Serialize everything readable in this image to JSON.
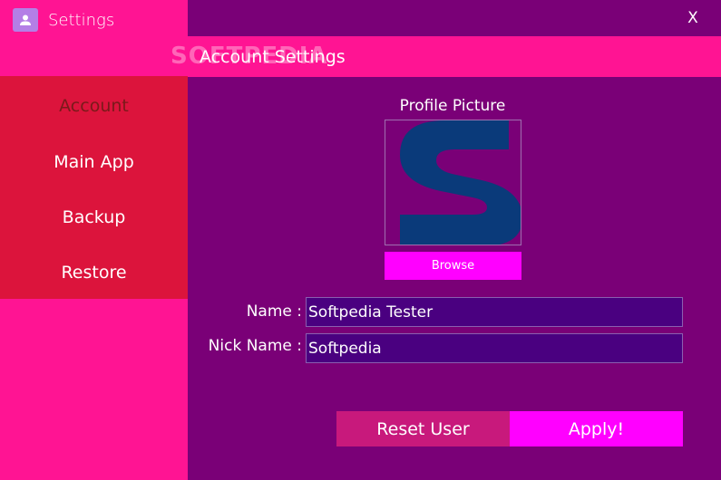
{
  "window": {
    "title": "Settings",
    "close_label": "X"
  },
  "sidebar": {
    "items": [
      {
        "label": "Account",
        "active": true
      },
      {
        "label": "Main App",
        "active": false
      },
      {
        "label": "Backup",
        "active": false
      },
      {
        "label": "Restore",
        "active": false
      }
    ]
  },
  "watermark": "SOFTPEDIA",
  "section": {
    "title": "Account Settings"
  },
  "profile": {
    "label": "Profile Picture",
    "browse_label": "Browse",
    "image_letter": "S"
  },
  "form": {
    "name_label": "Name :",
    "name_value": "Softpedia Tester",
    "nick_label": "Nick Name :",
    "nick_value": "Softpedia"
  },
  "actions": {
    "reset_label": "Reset User",
    "apply_label": "Apply!"
  },
  "colors": {
    "accent_pink": "#ff1493",
    "nav_red": "#dc143c",
    "content_purple": "#7a0077",
    "button_magenta": "#ff00ff",
    "logo_blue": "#0a3a7a"
  }
}
